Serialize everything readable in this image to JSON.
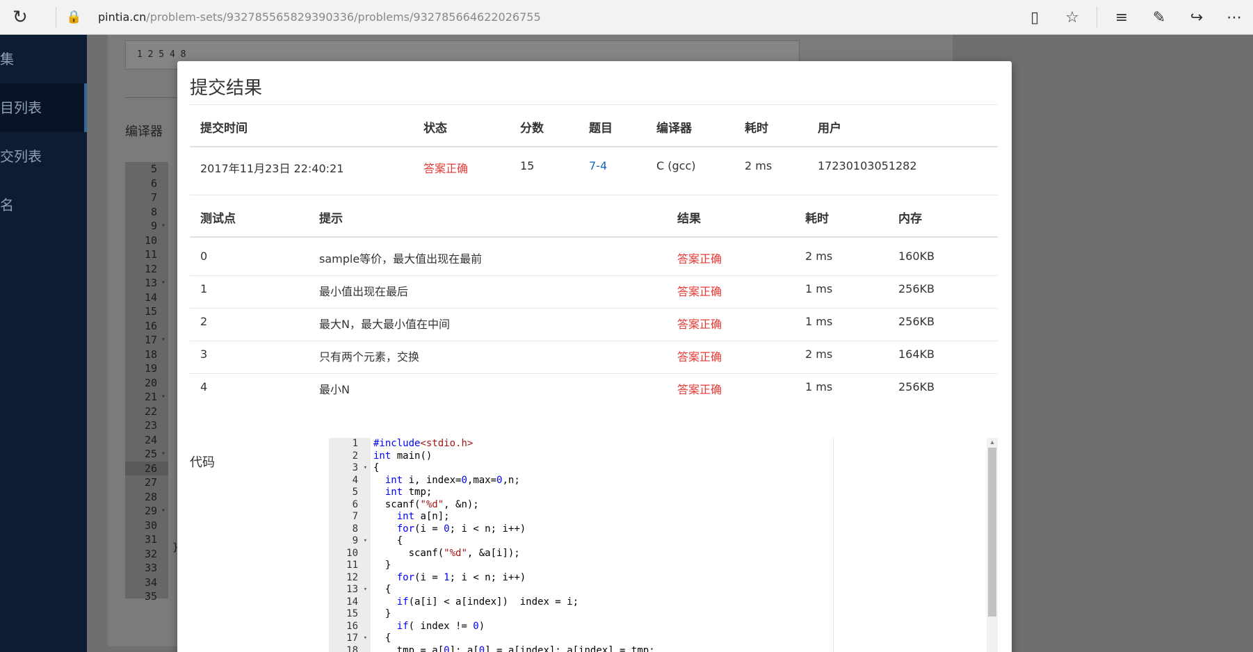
{
  "browser": {
    "url_host": "pintia.cn",
    "url_path": "/problem-sets/932785565829390336/problems/932785664622026755"
  },
  "sidebar": {
    "items": [
      {
        "label": "集"
      },
      {
        "label": "目列表"
      },
      {
        "label": "交列表"
      },
      {
        "label": "名"
      }
    ]
  },
  "background": {
    "sample_output": "1 2 5 4 8",
    "compiler_label": "编译器",
    "gutter_lines": [
      "5",
      "6",
      "7",
      "8",
      "9",
      "10",
      "11",
      "12",
      "13",
      "14",
      "15",
      "16",
      "17",
      "18",
      "19",
      "20",
      "21",
      "22",
      "23",
      "24",
      "25",
      "26",
      "27",
      "28",
      "29",
      "30",
      "31",
      "32",
      "33",
      "34",
      "35"
    ],
    "closing_brace": "}"
  },
  "modal": {
    "title": "提交结果",
    "submission": {
      "headers": [
        "提交时间",
        "状态",
        "分数",
        "题目",
        "编译器",
        "耗时",
        "用户"
      ],
      "row": {
        "time": "2017年11月23日 22:40:21",
        "status": "答案正确",
        "score": "15",
        "problem": "7-4",
        "compiler": "C (gcc)",
        "duration": "2 ms",
        "user": "17230103051282"
      }
    },
    "testcases": {
      "headers": [
        "测试点",
        "提示",
        "结果",
        "耗时",
        "内存"
      ],
      "rows": [
        {
          "id": "0",
          "hint": "sample等价，最大值出现在最前",
          "result": "答案正确",
          "time": "2 ms",
          "memory": "160KB"
        },
        {
          "id": "1",
          "hint": "最小值出现在最后",
          "result": "答案正确",
          "time": "1 ms",
          "memory": "256KB"
        },
        {
          "id": "2",
          "hint": "最大N，最大最小值在中间",
          "result": "答案正确",
          "time": "1 ms",
          "memory": "256KB"
        },
        {
          "id": "3",
          "hint": "只有两个元素，交换",
          "result": "答案正确",
          "time": "2 ms",
          "memory": "164KB"
        },
        {
          "id": "4",
          "hint": "最小N",
          "result": "答案正确",
          "time": "1 ms",
          "memory": "256KB"
        }
      ]
    },
    "code_label": "代码",
    "code_line_numbers": [
      "1",
      "2",
      "3",
      "4",
      "5",
      "6",
      "7",
      "8",
      "9",
      "10",
      "11",
      "12",
      "13",
      "14",
      "15",
      "16",
      "17",
      "18"
    ],
    "code_lines": [
      "#include<stdio.h>",
      "int main()",
      "{",
      "  int i, index=0,max=0,n;",
      "  int tmp;",
      "  scanf(\"%d\", &n);",
      "    int a[n];",
      "    for(i = 0; i < n; i++)",
      "    {",
      "      scanf(\"%d\", &a[i]);",
      "  }",
      "    for(i = 1; i < n; i++)",
      "  {",
      "    if(a[i] < a[index])  index = i;",
      "  }",
      "    if( index != 0)",
      "  {",
      "    tmp = a[0]; a[0] = a[index]; a[index] = tmp;"
    ]
  }
}
